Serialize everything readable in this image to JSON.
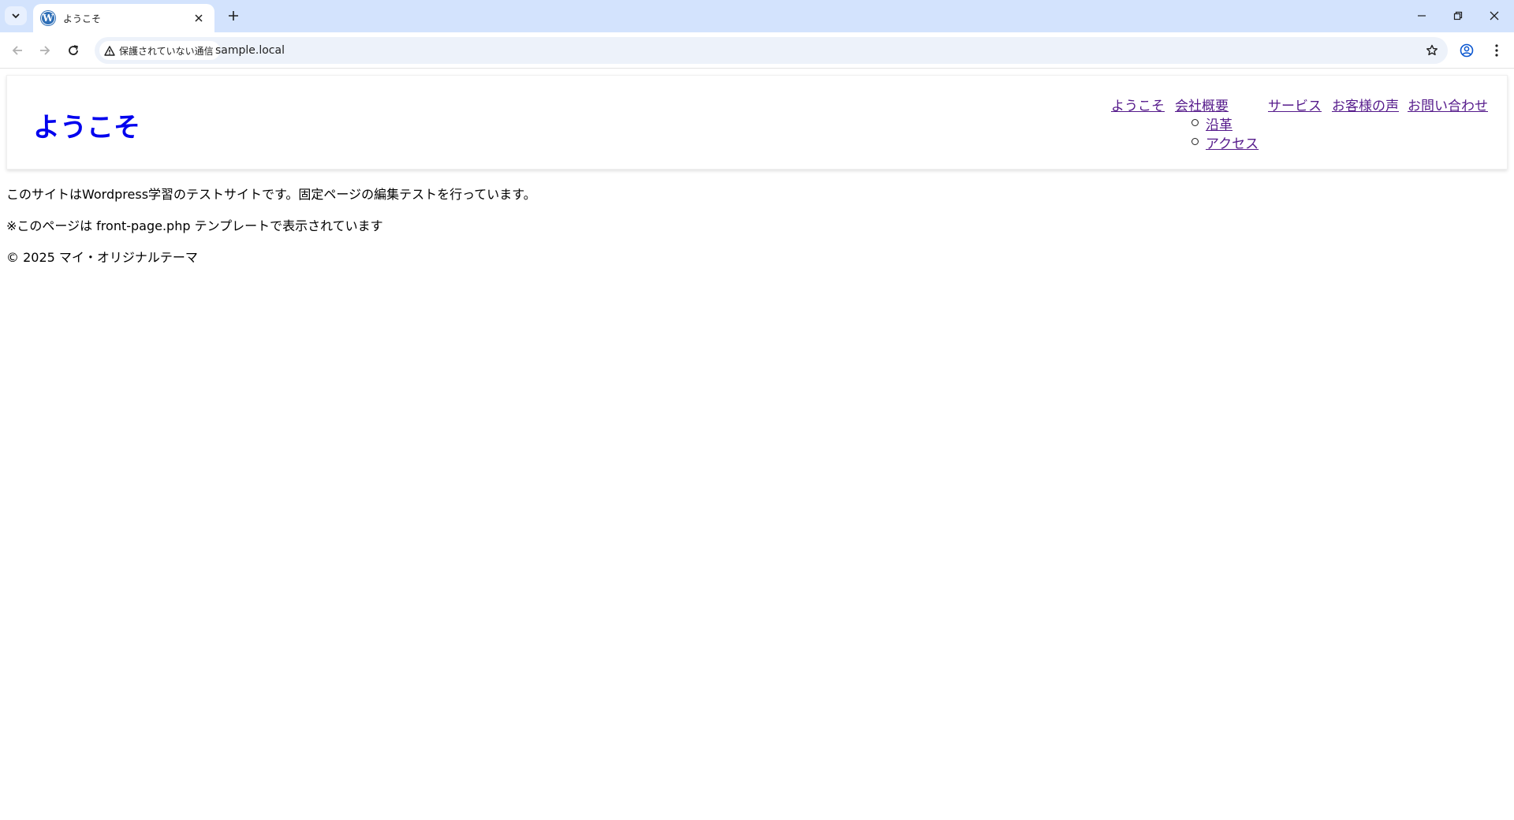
{
  "browser": {
    "tab": {
      "title": "ようこそ",
      "favicon": "wordpress-icon"
    },
    "omnibox": {
      "security_label": "保護されていない通信",
      "url": "sample.local"
    }
  },
  "site": {
    "title": "ようこそ",
    "nav": {
      "items": [
        {
          "label": "ようこそ"
        },
        {
          "label": "会社概要"
        },
        {
          "label": "サービス"
        },
        {
          "label": "お客様の声"
        },
        {
          "label": "お問い合わせ"
        }
      ],
      "submenu": [
        {
          "label": "沿革"
        },
        {
          "label": "アクセス"
        }
      ]
    },
    "content": {
      "paragraph1": "このサイトはWordpress学習のテストサイトです。固定ページの編集テストを行っています。",
      "paragraph2": "※このページは front-page.php テンプレートで表示されています"
    },
    "footer": {
      "copyright": "© 2025 マイ・オリジナルテーマ"
    }
  },
  "colors": {
    "tabstrip": "#d3e3fd",
    "omnibox": "#edf2fa",
    "site_title": "#0000ee",
    "visited_link": "#551a8b"
  }
}
